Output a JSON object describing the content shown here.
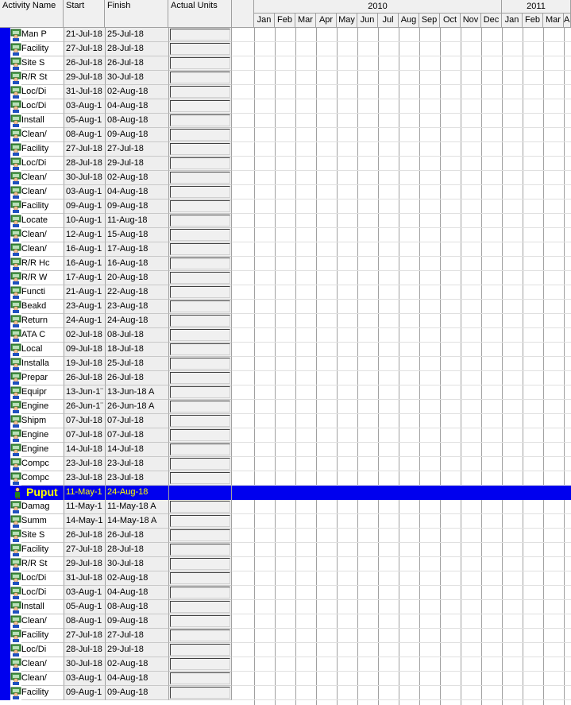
{
  "header": {
    "activity_name": "Activity Name",
    "start": "Start",
    "finish": "Finish",
    "actual_units": "Actual Units",
    "years": [
      "2010",
      "2011"
    ],
    "months_2010": [
      "Jan",
      "Feb",
      "Mar",
      "Apr",
      "May",
      "Jun",
      "Jul",
      "Aug",
      "Sep",
      "Oct",
      "Nov",
      "Dec"
    ],
    "months_2011": [
      "Jan",
      "Feb",
      "Mar",
      "Ap"
    ]
  },
  "rows": [
    {
      "name": "Man P",
      "start": "21-Jul-18",
      "finish": "25-Jul-18"
    },
    {
      "name": "Facility",
      "start": "27-Jul-18",
      "finish": "28-Jul-18"
    },
    {
      "name": "Site S",
      "start": "26-Jul-18",
      "finish": "26-Jul-18"
    },
    {
      "name": "R/R St",
      "start": "29-Jul-18",
      "finish": "30-Jul-18"
    },
    {
      "name": "Loc/Di",
      "start": "31-Jul-18",
      "finish": "02-Aug-18"
    },
    {
      "name": "Loc/Di",
      "start": "03-Aug-1",
      "finish": "04-Aug-18"
    },
    {
      "name": "Install",
      "start": "05-Aug-1",
      "finish": "08-Aug-18"
    },
    {
      "name": "Clean/",
      "start": "08-Aug-1",
      "finish": "09-Aug-18"
    },
    {
      "name": "Facility",
      "start": "27-Jul-18",
      "finish": "27-Jul-18"
    },
    {
      "name": "Loc/Di",
      "start": "28-Jul-18",
      "finish": "29-Jul-18"
    },
    {
      "name": "Clean/",
      "start": "30-Jul-18",
      "finish": "02-Aug-18"
    },
    {
      "name": "Clean/",
      "start": "03-Aug-1",
      "finish": "04-Aug-18"
    },
    {
      "name": "Facility",
      "start": "09-Aug-1",
      "finish": "09-Aug-18"
    },
    {
      "name": "Locate",
      "start": "10-Aug-1",
      "finish": "11-Aug-18"
    },
    {
      "name": "Clean/",
      "start": "12-Aug-1",
      "finish": "15-Aug-18"
    },
    {
      "name": "Clean/",
      "start": "16-Aug-1",
      "finish": "17-Aug-18"
    },
    {
      "name": "R/R Hc",
      "start": "16-Aug-1",
      "finish": "16-Aug-18"
    },
    {
      "name": "R/R W",
      "start": "17-Aug-1",
      "finish": "20-Aug-18"
    },
    {
      "name": "Functi",
      "start": "21-Aug-1",
      "finish": "22-Aug-18"
    },
    {
      "name": "Beakd",
      "start": "23-Aug-1",
      "finish": "23-Aug-18"
    },
    {
      "name": "Return",
      "start": "24-Aug-1",
      "finish": "24-Aug-18"
    },
    {
      "name": "ATA C",
      "start": "02-Jul-18",
      "finish": "08-Jul-18"
    },
    {
      "name": "Local",
      "start": "09-Jul-18",
      "finish": "18-Jul-18"
    },
    {
      "name": "Installa",
      "start": "19-Jul-18",
      "finish": "25-Jul-18"
    },
    {
      "name": "Prepar",
      "start": "26-Jul-18",
      "finish": "26-Jul-18"
    },
    {
      "name": "Equipr",
      "start": "13-Jun-1¨",
      "finish": "13-Jun-18 A"
    },
    {
      "name": "Engine",
      "start": "26-Jun-1¨",
      "finish": "26-Jun-18 A"
    },
    {
      "name": "Shipm",
      "start": "07-Jul-18",
      "finish": "07-Jul-18"
    },
    {
      "name": "Engine",
      "start": "07-Jul-18",
      "finish": "07-Jul-18"
    },
    {
      "name": "Engine",
      "start": "14-Jul-18",
      "finish": "14-Jul-18"
    },
    {
      "name": "Compc",
      "start": "23-Jul-18",
      "finish": "23-Jul-18"
    },
    {
      "name": "Compc",
      "start": "23-Jul-18",
      "finish": "23-Jul-18"
    },
    {
      "wbs": true,
      "name": "Puput",
      "start": "11-May-1",
      "finish": "24-Aug-18"
    },
    {
      "name": "Damag",
      "start": "11-May-1",
      "finish": "11-May-18 A"
    },
    {
      "name": "Summ",
      "start": "14-May-1",
      "finish": "14-May-18 A"
    },
    {
      "name": "Site S",
      "start": "26-Jul-18",
      "finish": "26-Jul-18"
    },
    {
      "name": "Facility",
      "start": "27-Jul-18",
      "finish": "28-Jul-18"
    },
    {
      "name": "R/R St",
      "start": "29-Jul-18",
      "finish": "30-Jul-18"
    },
    {
      "name": "Loc/Di",
      "start": "31-Jul-18",
      "finish": "02-Aug-18"
    },
    {
      "name": "Loc/Di",
      "start": "03-Aug-1",
      "finish": "04-Aug-18"
    },
    {
      "name": "Install",
      "start": "05-Aug-1",
      "finish": "08-Aug-18"
    },
    {
      "name": "Clean/",
      "start": "08-Aug-1",
      "finish": "09-Aug-18"
    },
    {
      "name": "Facility",
      "start": "27-Jul-18",
      "finish": "27-Jul-18"
    },
    {
      "name": "Loc/Di",
      "start": "28-Jul-18",
      "finish": "29-Jul-18"
    },
    {
      "name": "Clean/",
      "start": "30-Jul-18",
      "finish": "02-Aug-18"
    },
    {
      "name": "Clean/",
      "start": "03-Aug-1",
      "finish": "04-Aug-18"
    },
    {
      "name": "Facility",
      "start": "09-Aug-1",
      "finish": "09-Aug-18"
    }
  ],
  "colors": {
    "wbs_band": "#0000ee",
    "wbs_text": "#ffff00",
    "header_bg": "#f0f0f0"
  }
}
